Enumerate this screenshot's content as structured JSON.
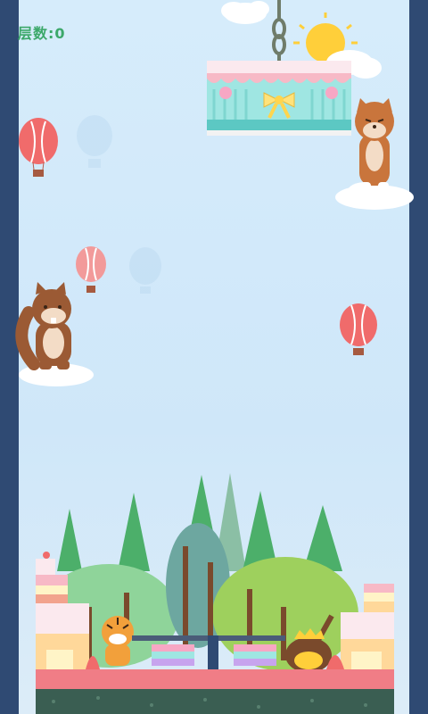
{
  "hud": {
    "floor_label": "层数:",
    "floor_value": "0"
  },
  "colors": {
    "wall": "#2f4a73",
    "sky": "#d6ecfb",
    "score_text": "#3ca86a",
    "balloon": "#f06b6b",
    "ground": "#f07d86",
    "tree": "#4caf6a"
  },
  "icons": {
    "sun": "sun-icon",
    "cloud": "cloud-icon",
    "balloon": "hot-air-balloon-icon",
    "chain": "chain-hook-icon"
  }
}
